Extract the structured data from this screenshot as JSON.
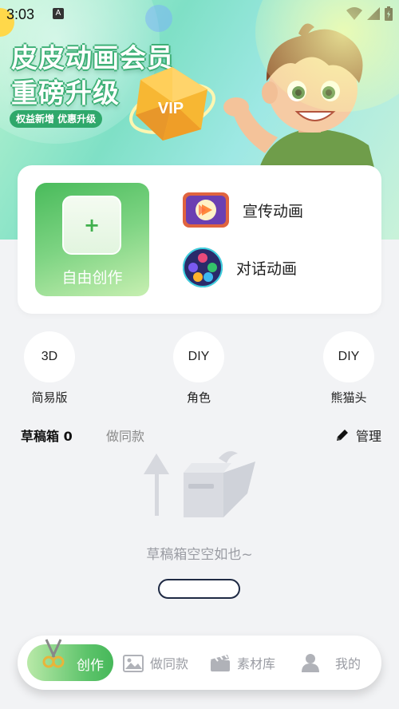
{
  "status": {
    "time": "3:03",
    "notification_letter": "A"
  },
  "banner": {
    "title_line1": "皮皮动画会员",
    "title_line2": "重磅升级",
    "tag": "权益新增  优惠升级",
    "gem_text": "VIP"
  },
  "create": {
    "free_label": "自由创作",
    "plus": "+",
    "promo_label": "宣传动画",
    "dialog_label": "对话动画"
  },
  "quick": [
    {
      "icon_text": "3D",
      "label": "简易版"
    },
    {
      "icon_text": "DIY",
      "label": "角色"
    },
    {
      "icon_text": "DIY",
      "label": "熊猫头"
    }
  ],
  "drafts": {
    "tab_drafts": "草稿箱 0",
    "tab_same": "做同款",
    "manage": "管理",
    "empty_text": "草稿箱空空如也~"
  },
  "nav": [
    {
      "label": "创作",
      "icon": "scissors-icon",
      "active": true
    },
    {
      "label": "做同款",
      "icon": "image-icon"
    },
    {
      "label": "素材库",
      "icon": "clapperboard-icon"
    },
    {
      "label": "我的",
      "icon": "person-icon"
    }
  ],
  "colors": {
    "brand_green": "#49bb5b",
    "accent_dark": "#1f2a44"
  }
}
